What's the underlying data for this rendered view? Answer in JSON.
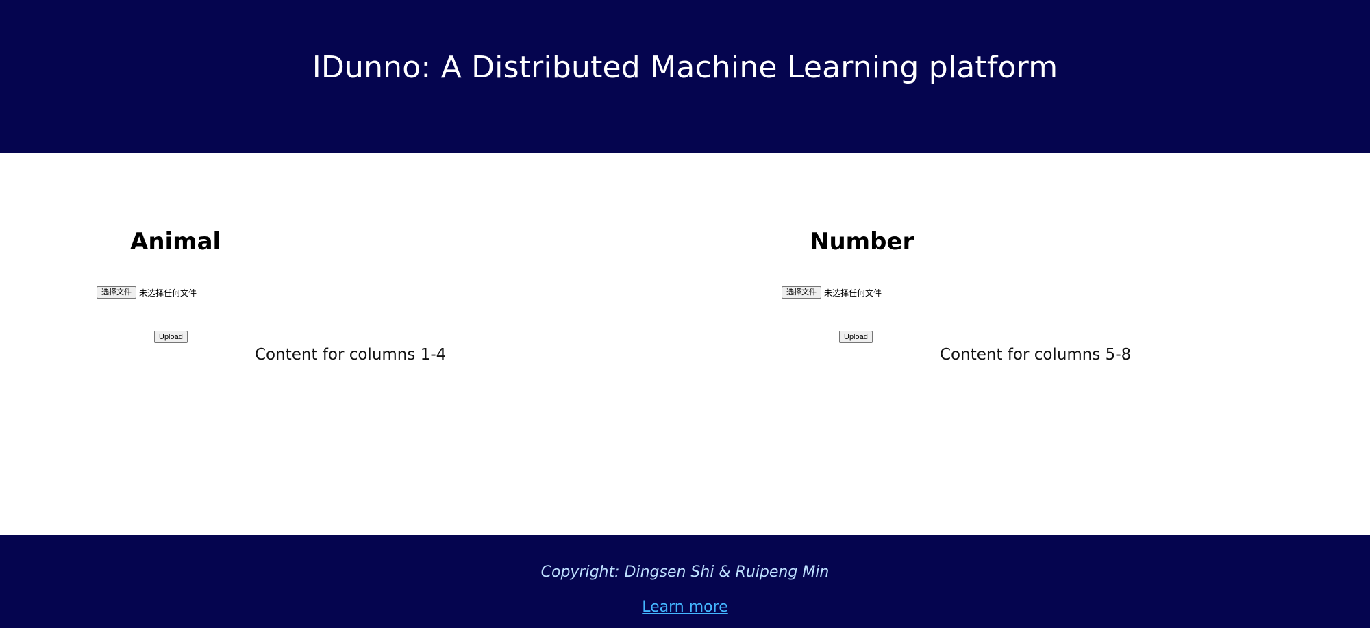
{
  "header": {
    "title": "IDunno: A Distributed Machine Learning platform"
  },
  "panels": [
    {
      "title": "Animal",
      "file_button_label": "选择文件",
      "file_status": "未选择任何文件",
      "upload_label": "Upload",
      "content": "Content for columns 1-4"
    },
    {
      "title": "Number",
      "file_button_label": "选择文件",
      "file_status": "未选择任何文件",
      "upload_label": "Upload",
      "content": "Content for columns 5-8"
    }
  ],
  "footer": {
    "copyright": "Copyright: Dingsen Shi & Ruipeng Min",
    "learn_more": "Learn more"
  },
  "colors": {
    "header_bg": "#05054f",
    "footer_bg": "#05054f",
    "footer_text": "#bfe1ff",
    "link": "#44b6ff"
  }
}
